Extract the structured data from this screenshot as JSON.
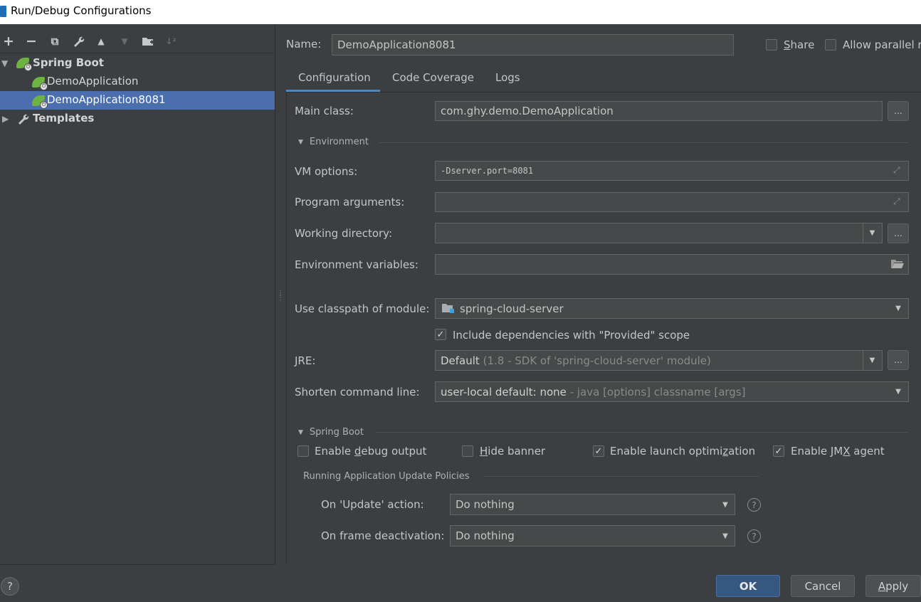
{
  "window": {
    "title": "Run/Debug Configurations"
  },
  "toolbar": {
    "add": "+",
    "remove": "−",
    "copy": "⧉",
    "edit": "🔧",
    "up": "▲",
    "down": "▼",
    "folder": "▣",
    "sort": "↓²"
  },
  "tree": {
    "spring_boot": "Spring Boot",
    "items": [
      "DemoApplication",
      "DemoApplication8081"
    ],
    "templates": "Templates"
  },
  "header": {
    "name_label": "Name:",
    "name_value": "DemoApplication8081",
    "share": "Share",
    "allow_parallel": "Allow parallel r"
  },
  "tabs": [
    "Configuration",
    "Code Coverage",
    "Logs"
  ],
  "config": {
    "main_class_label": "Main class:",
    "main_class_value": "com.ghy.demo.DemoApplication",
    "environment_section": "Environment",
    "vm_options_label": "VM options:",
    "vm_options_value": "-Dserver.port=8081",
    "program_args_label": "Program arguments:",
    "working_dir_label": "Working directory:",
    "env_vars_label": "Environment variables:",
    "classpath_label": "Use classpath of module:",
    "classpath_value": "spring-cloud-server",
    "include_deps": "Include dependencies with \"Provided\" scope",
    "jre_label": "JRE:",
    "jre_value_main": "Default",
    "jre_value_detail": "(1.8 - SDK of 'spring-cloud-server' module)",
    "shorten_label": "Shorten command line:",
    "shorten_value_main": "user-local default: none",
    "shorten_value_detail": "- java [options] classname [args]"
  },
  "spring_boot": {
    "section": "Spring Boot",
    "debug_output": "Enable debug output",
    "hide_banner": "Hide banner",
    "launch_opt": "Enable launch optimization",
    "jmx_agent": "Enable JMX agent",
    "policies_title": "Running Application Update Policies",
    "update_label": "On 'Update' action:",
    "update_value": "Do nothing",
    "frame_label": "On frame deactivation:",
    "frame_value": "Do nothing"
  },
  "buttons": {
    "ok": "OK",
    "cancel": "Cancel",
    "apply": "Apply",
    "help": "?"
  }
}
